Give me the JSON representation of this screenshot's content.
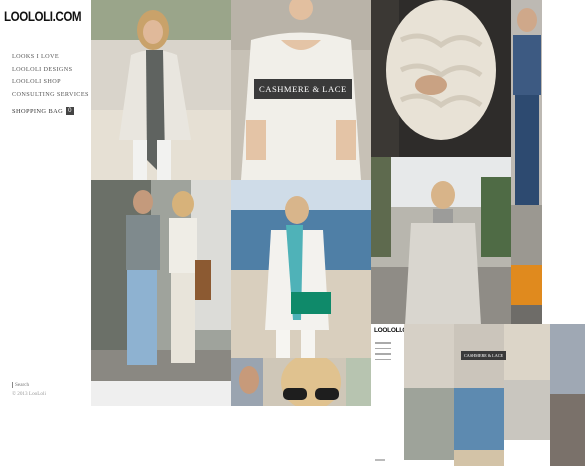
{
  "logo": "LOOLOLI.COM",
  "nav": [
    {
      "label": "Looks I Love"
    },
    {
      "label": "Loololi Designs"
    },
    {
      "label": "Loololi Shop"
    },
    {
      "label": "Consulting Services"
    }
  ],
  "shopping_bag": {
    "label": "Shopping Bag",
    "count": "0"
  },
  "footer": {
    "search": "Search",
    "copyright": "© 2013 LooLoli"
  },
  "overlay": {
    "label": "Cashmere & Lace"
  },
  "mini_page": {
    "logo": "LOOLOLI.COM",
    "label": "Cashmere & Lace"
  },
  "colors": {
    "overlay_bg": "#3a3a3a",
    "text": "#555555",
    "background": "#ffffff"
  },
  "tiles": [
    {
      "name": "photo-woman-gray-scarf"
    },
    {
      "name": "photo-cashmere-lace-sweater"
    },
    {
      "name": "photo-chunky-knit-scarf"
    },
    {
      "name": "photo-man-jeans-edge"
    },
    {
      "name": "photo-couple-walking"
    },
    {
      "name": "photo-teal-scarf-beach"
    },
    {
      "name": "photo-trench-coat-street"
    },
    {
      "name": "photo-sunglasses-closeup"
    }
  ]
}
